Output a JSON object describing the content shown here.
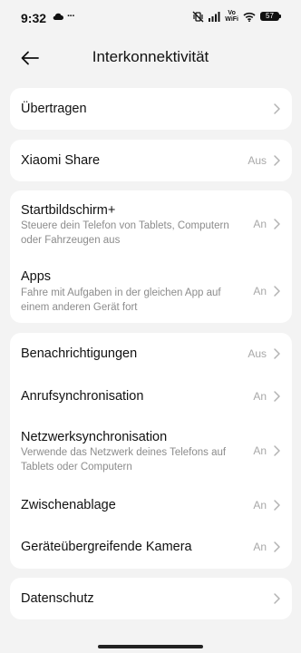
{
  "status_bar": {
    "time": "9:32",
    "overflow": "···",
    "volte": "Vo",
    "wifi_label": "WiFi",
    "battery": "57",
    "icons": [
      "cloud-icon",
      "mute-vibrate-icon",
      "signal-icon",
      "wifi-icon",
      "battery-icon"
    ]
  },
  "header": {
    "title": "Interkonnektivität",
    "back_icon": "back-arrow-icon"
  },
  "sections": [
    {
      "items": [
        {
          "title": "Übertragen",
          "subtitle": "",
          "value": ""
        }
      ]
    },
    {
      "items": [
        {
          "title": "Xiaomi Share",
          "subtitle": "",
          "value": "Aus"
        }
      ]
    },
    {
      "items": [
        {
          "title": "Startbildschirm+",
          "subtitle": "Steuere dein Telefon von Tablets, Computern oder Fahrzeugen aus",
          "value": "An"
        },
        {
          "title": "Apps",
          "subtitle": "Fahre mit Aufgaben in der gleichen App auf einem anderen Gerät fort",
          "value": "An"
        }
      ]
    },
    {
      "items": [
        {
          "title": "Benachrichtigungen",
          "subtitle": "",
          "value": "Aus"
        },
        {
          "title": "Anrufsynchronisation",
          "subtitle": "",
          "value": "An"
        },
        {
          "title": "Netzwerksynchronisation",
          "subtitle": "Verwende das Netzwerk deines Telefons auf Tablets oder Computern",
          "value": "An"
        },
        {
          "title": "Zwischenablage",
          "subtitle": "",
          "value": "An"
        },
        {
          "title": "Geräteübergreifende Kamera",
          "subtitle": "",
          "value": "An"
        }
      ]
    },
    {
      "items": [
        {
          "title": "Datenschutz",
          "subtitle": "",
          "value": ""
        }
      ]
    }
  ]
}
